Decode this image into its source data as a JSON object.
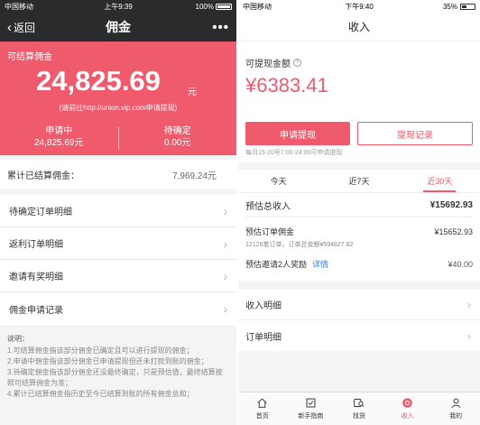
{
  "left": {
    "status": {
      "carrier": "中国移动",
      "time": "上午9:39",
      "battery": "100%"
    },
    "nav": {
      "back_label": "返回",
      "title": "佣金",
      "more": "•••"
    },
    "hero": {
      "label": "可结算佣金",
      "amount": "24,825.69",
      "unit": "元",
      "hint": "(请前往http://union.vip.com申请提现)",
      "stats": [
        {
          "label": "申请中",
          "value": "24,825.69元"
        },
        {
          "label": "待确定",
          "value": "0.00元"
        }
      ]
    },
    "total": {
      "label": "累计已结算佣金：",
      "value": "7,969.24元"
    },
    "items": [
      {
        "label": "待确定订单明细"
      },
      {
        "label": "返利订单明细"
      },
      {
        "label": "邀请有奖明细"
      },
      {
        "label": "佣金申请记录"
      }
    ],
    "notes": {
      "heading": "说明：",
      "lines": [
        "1.可结算佣金指该部分佣金已确定且可以进行提现的佣金；",
        "2.申请中佣金指该部分佣金已申请提现但还未打款到账的佣金；",
        "3.待确定佣金指该部分佣金还没最终确定，只是预估值，最终结算按照可结算佣金为准；",
        "4.累计已结算佣金指历史至今已结算到账的所有佣金总和；"
      ]
    }
  },
  "right": {
    "status": {
      "carrier": "中国移动",
      "time": "下午9:40",
      "battery": "35%"
    },
    "nav": {
      "title": "收入"
    },
    "card": {
      "label": "可提现金额",
      "amount": "¥6383.41",
      "apply_button": "申请提现",
      "record_button": "提现记录",
      "note": "每月15-20号7:00-24:00可申请提现"
    },
    "tabs": [
      {
        "label": "今天",
        "active": false
      },
      {
        "label": "近7天",
        "active": false
      },
      {
        "label": "近30天",
        "active": true
      }
    ],
    "stats": {
      "total_label": "预估总收入",
      "total_value": "¥15692.93",
      "order_label": "预估订单佣金",
      "order_value": "¥15652.93",
      "order_note": "12126笔订单，订单总金额¥594827.82",
      "invite_label": "预估邀请2人奖励",
      "invite_link": "详情",
      "invite_value": "¥40.00"
    },
    "items": [
      {
        "label": "收入明细"
      },
      {
        "label": "订单明细"
      }
    ],
    "tabbar": [
      {
        "label": "首页",
        "icon": "home-icon"
      },
      {
        "label": "新手指南",
        "icon": "guide-icon"
      },
      {
        "label": "找货",
        "icon": "search-goods-icon"
      },
      {
        "label": "收入",
        "icon": "income-icon"
      },
      {
        "label": "我的",
        "icon": "profile-icon"
      }
    ],
    "accent": "#ef5a6c"
  }
}
